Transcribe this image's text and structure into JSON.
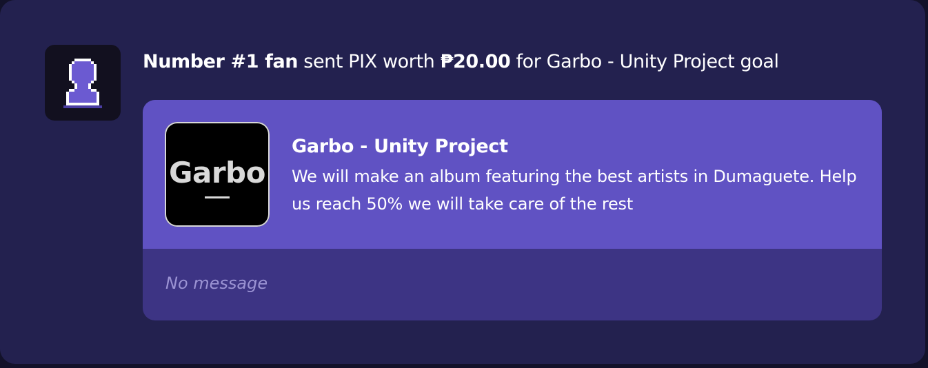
{
  "alert": {
    "sender_name": "Number #1 fan",
    "action_text": " sent PIX worth ",
    "amount": "₱20.00",
    "goal_text": " for Garbo - Unity Project goal"
  },
  "avatar": {
    "icon": "user-silhouette-icon"
  },
  "goal": {
    "thumbnail_text": "Garbo",
    "title": "Garbo - Unity Project",
    "description": "We will make an album featuring the best artists in Dumaguete. Help us reach 50% we will take care of the rest"
  },
  "message": {
    "text": "No message"
  },
  "colors": {
    "card_background": "#23214f",
    "goal_header": "#6052c3",
    "goal_footer": "#3d3484",
    "message_text": "#9b93d3",
    "avatar_accent": "#6b5ad1"
  }
}
